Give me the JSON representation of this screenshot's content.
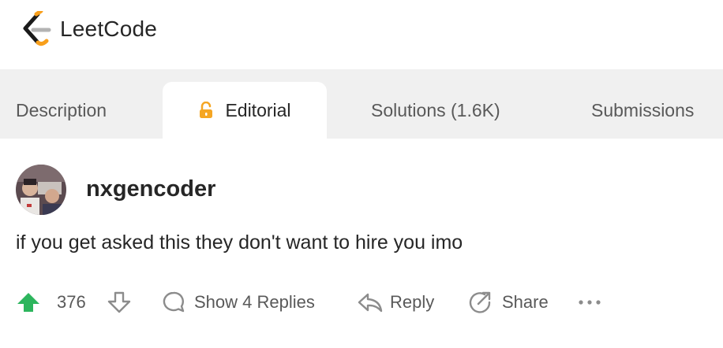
{
  "brand": {
    "name": "LeetCode"
  },
  "tabs": [
    {
      "label": "Description",
      "active": false
    },
    {
      "label": "Editorial",
      "active": true,
      "icon": "unlock-icon"
    },
    {
      "label": "Solutions (1.6K)",
      "active": false
    },
    {
      "label": "Submissions",
      "active": false
    }
  ],
  "comment": {
    "username": "nxgencoder",
    "text": "if you get asked this they don't want to hire you imo",
    "votes": "376",
    "show_replies_label": "Show 4 Replies",
    "reply_label": "Reply",
    "share_label": "Share"
  },
  "colors": {
    "upvote": "#2db55d",
    "lock": "#f5a623",
    "tabbar_bg": "#f0f0f0",
    "text_primary": "#262626",
    "text_secondary": "#595959"
  }
}
